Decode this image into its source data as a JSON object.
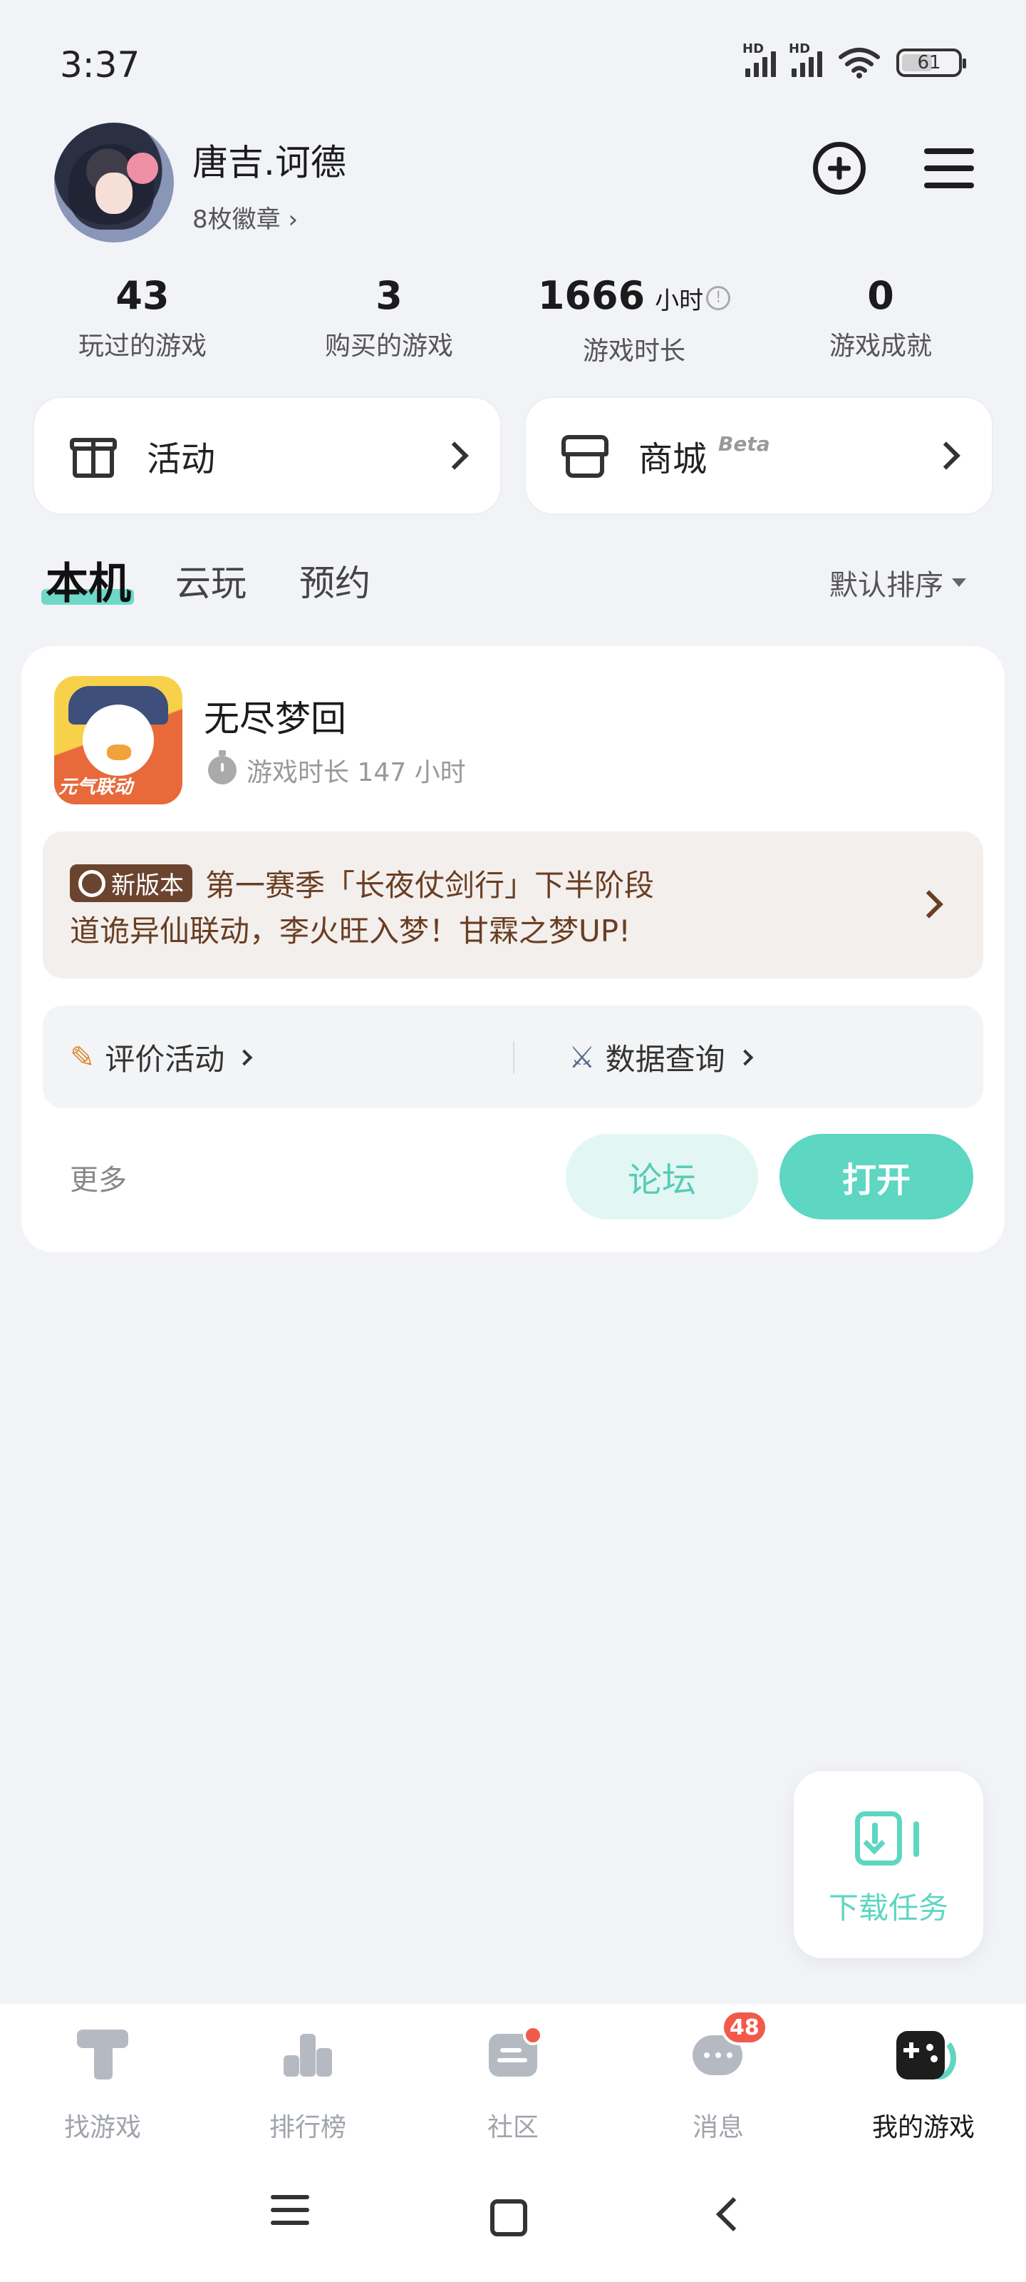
{
  "status_bar": {
    "time": "3:37",
    "hd1": "HD",
    "hd2": "HD",
    "battery": "61"
  },
  "profile": {
    "username": "唐吉.诃德",
    "badges": "8枚徽章 ›"
  },
  "stats": [
    {
      "value": "43",
      "label": "玩过的游戏"
    },
    {
      "value": "3",
      "label": "购买的游戏"
    },
    {
      "value": "1666",
      "unit": "小时",
      "label": "游戏时长"
    },
    {
      "value": "0",
      "label": "游戏成就"
    }
  ],
  "quick_cards": {
    "activity": "活动",
    "store": "商城",
    "store_tag": "Beta"
  },
  "tabs": {
    "local": "本机",
    "cloud": "云玩",
    "reserve": "预约",
    "sort": "默认排序"
  },
  "game": {
    "title": "无尽梦回",
    "icon_tag": "元气联动",
    "playtime": "游戏时长 147 小时",
    "news_tag": "新版本",
    "news_line1": "第一赛季「长夜仗剑行」下半阶段",
    "news_line2": "道诡异仙联动，李火旺入梦！甘霖之梦UP!",
    "link_review": "评价活动",
    "link_data": "数据查询",
    "more": "更多",
    "forum": "论坛",
    "open": "打开"
  },
  "download": {
    "label": "下载任务"
  },
  "bottom_nav": {
    "find": "找游戏",
    "rank": "排行榜",
    "community": "社区",
    "messages": "消息",
    "messages_badge": "48",
    "mine": "我的游戏"
  },
  "colors": {
    "accent": "#5dd6c2",
    "news_bg": "#f3efec",
    "news_text": "#6a3e23",
    "badge_red": "#f15a4a"
  },
  "icons": [
    "plus-circle-icon",
    "menu-icon",
    "gift-icon",
    "store-icon",
    "chevron-right-icon",
    "stopwatch-icon",
    "pencil-icon",
    "swords-icon",
    "download-icon",
    "find-game-icon",
    "ranking-icon",
    "community-icon",
    "message-icon",
    "my-games-icon"
  ]
}
